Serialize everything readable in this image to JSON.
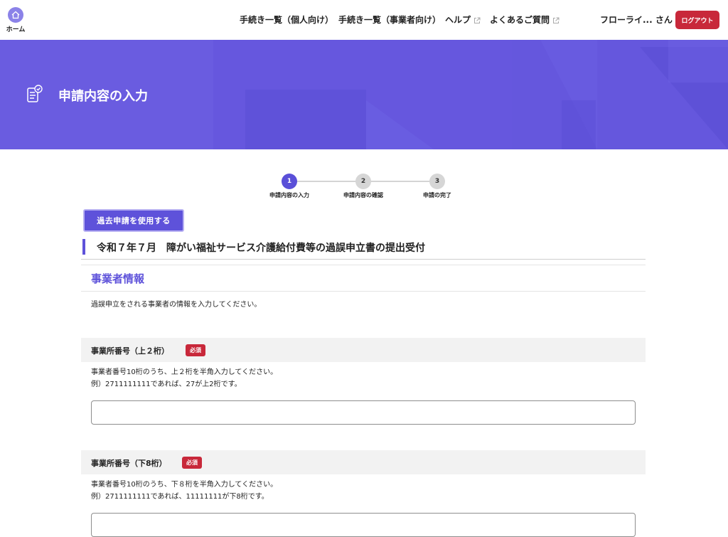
{
  "header": {
    "home_label": "ホーム",
    "nav": [
      {
        "label": "手続き一覧（個人向け）",
        "external": false
      },
      {
        "label": "手続き一覧（事業者向け）",
        "external": false
      },
      {
        "label": "ヘルプ",
        "external": true
      },
      {
        "label": "よくあるご質問",
        "external": true
      }
    ],
    "user_name": "フローライ... さん",
    "logout_label": "ログアウト"
  },
  "banner": {
    "title": "申請内容の入力"
  },
  "stepper": {
    "steps": [
      {
        "number": "1",
        "label": "申請内容の入力",
        "active": true
      },
      {
        "number": "2",
        "label": "申請内容の確認",
        "active": false
      },
      {
        "number": "3",
        "label": "申請の完了",
        "active": false
      }
    ]
  },
  "past_application_button": "過去申請を使用する",
  "procedure_title": "令和７年７月　障がい福祉サービス介護給付費等の過誤申立書の提出受付",
  "section": {
    "title": "事業者情報",
    "description": "過誤申立をされる事業者の情報を入力してください。"
  },
  "fields": [
    {
      "label": "事業所番号（上２桁）",
      "required_label": "必須",
      "hint_lines": [
        "事業者番号10桁のうち、上２桁を半角入力してください。",
        "例）2711111111であれば、27が上2桁です。"
      ],
      "value": ""
    },
    {
      "label": "事業所番号（下8桁）",
      "required_label": "必須",
      "hint_lines": [
        "事業者番号10桁のうち、下８桁を半角入力してください。",
        "例）2711111111であれば、11111111が下8桁です。"
      ],
      "value": ""
    }
  ],
  "colors": {
    "accent": "#5e52da",
    "banner": "#6a5ce0",
    "danger": "#c8283a"
  }
}
